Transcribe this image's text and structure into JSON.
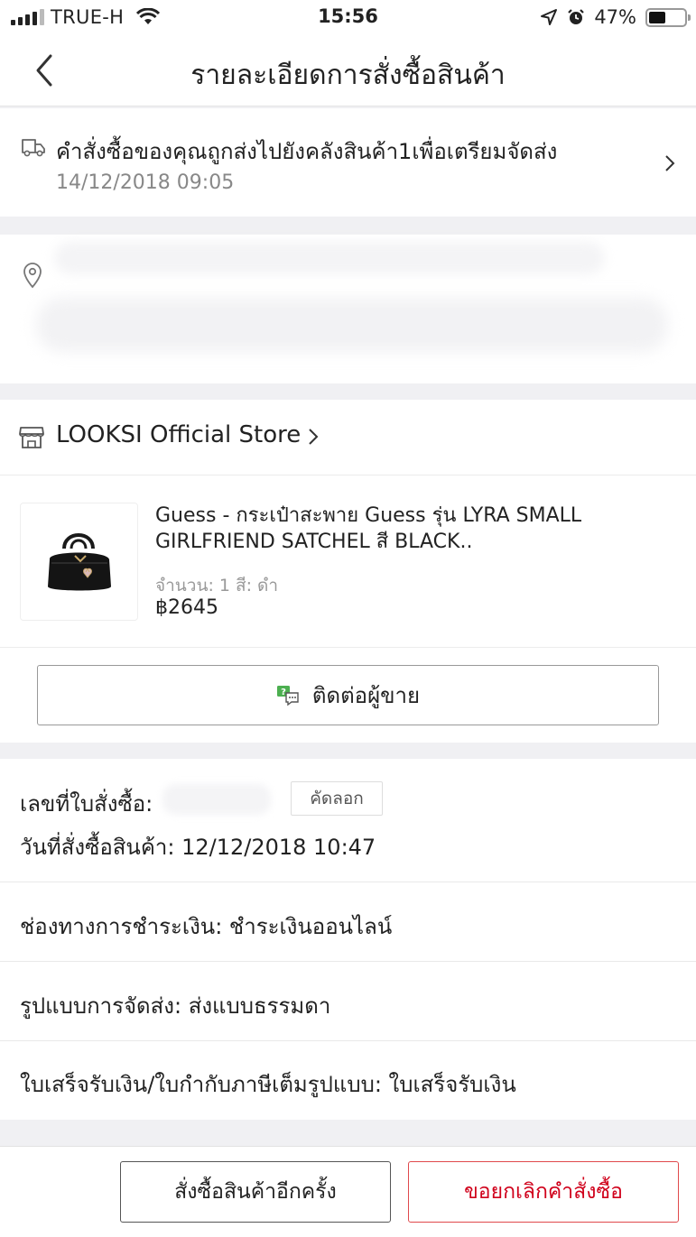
{
  "status_bar": {
    "carrier": "TRUE-H",
    "time": "15:56",
    "battery_percent": "47%",
    "battery_level": 0.47
  },
  "nav": {
    "title": "รายละเอียดการสั่งซื้อสินค้า"
  },
  "shipment": {
    "status": "คำสั่งซื้อของคุณถูกส่งไปยังคลังสินค้า1เพื่อเตรียมจัดส่ง",
    "timestamp": "14/12/2018 09:05"
  },
  "store": {
    "name": "LOOKSI Official Store"
  },
  "product": {
    "name": "Guess - กระเป๋าสะพาย Guess  รุ่น LYRA SMALL GIRLFRIEND SATCHEL สี BLACK..",
    "meta": "จำนวน: 1 สี: ดำ",
    "price": "฿2645"
  },
  "contact_seller_label": "ติดต่อผู้ขาย",
  "order": {
    "number_label": "เลขที่ใบสั่งซื้อ:",
    "copy_label": "คัดลอก",
    "date_label": "วันที่สั่งซื้อสินค้า: 12/12/2018 10:47",
    "payment_label": "ช่องทางการชำระเงิน: ชำระเงินออนไลน์",
    "shipping_label": "รูปแบบการจัดส่ง: ส่งแบบธรรมดา",
    "invoice_label": "ใบเสร็จรับเงิน/ใบกำกับภาษีเต็มรูปแบบ: ใบเสร็จรับเงิน"
  },
  "actions": {
    "reorder_label": "สั่งซื้อสินค้าอีกครั้ง",
    "cancel_label": "ขอยกเลิกคำสั่งซื้อ"
  },
  "colors": {
    "accent_red": "#d0011b",
    "background": "#f0f0f3"
  }
}
